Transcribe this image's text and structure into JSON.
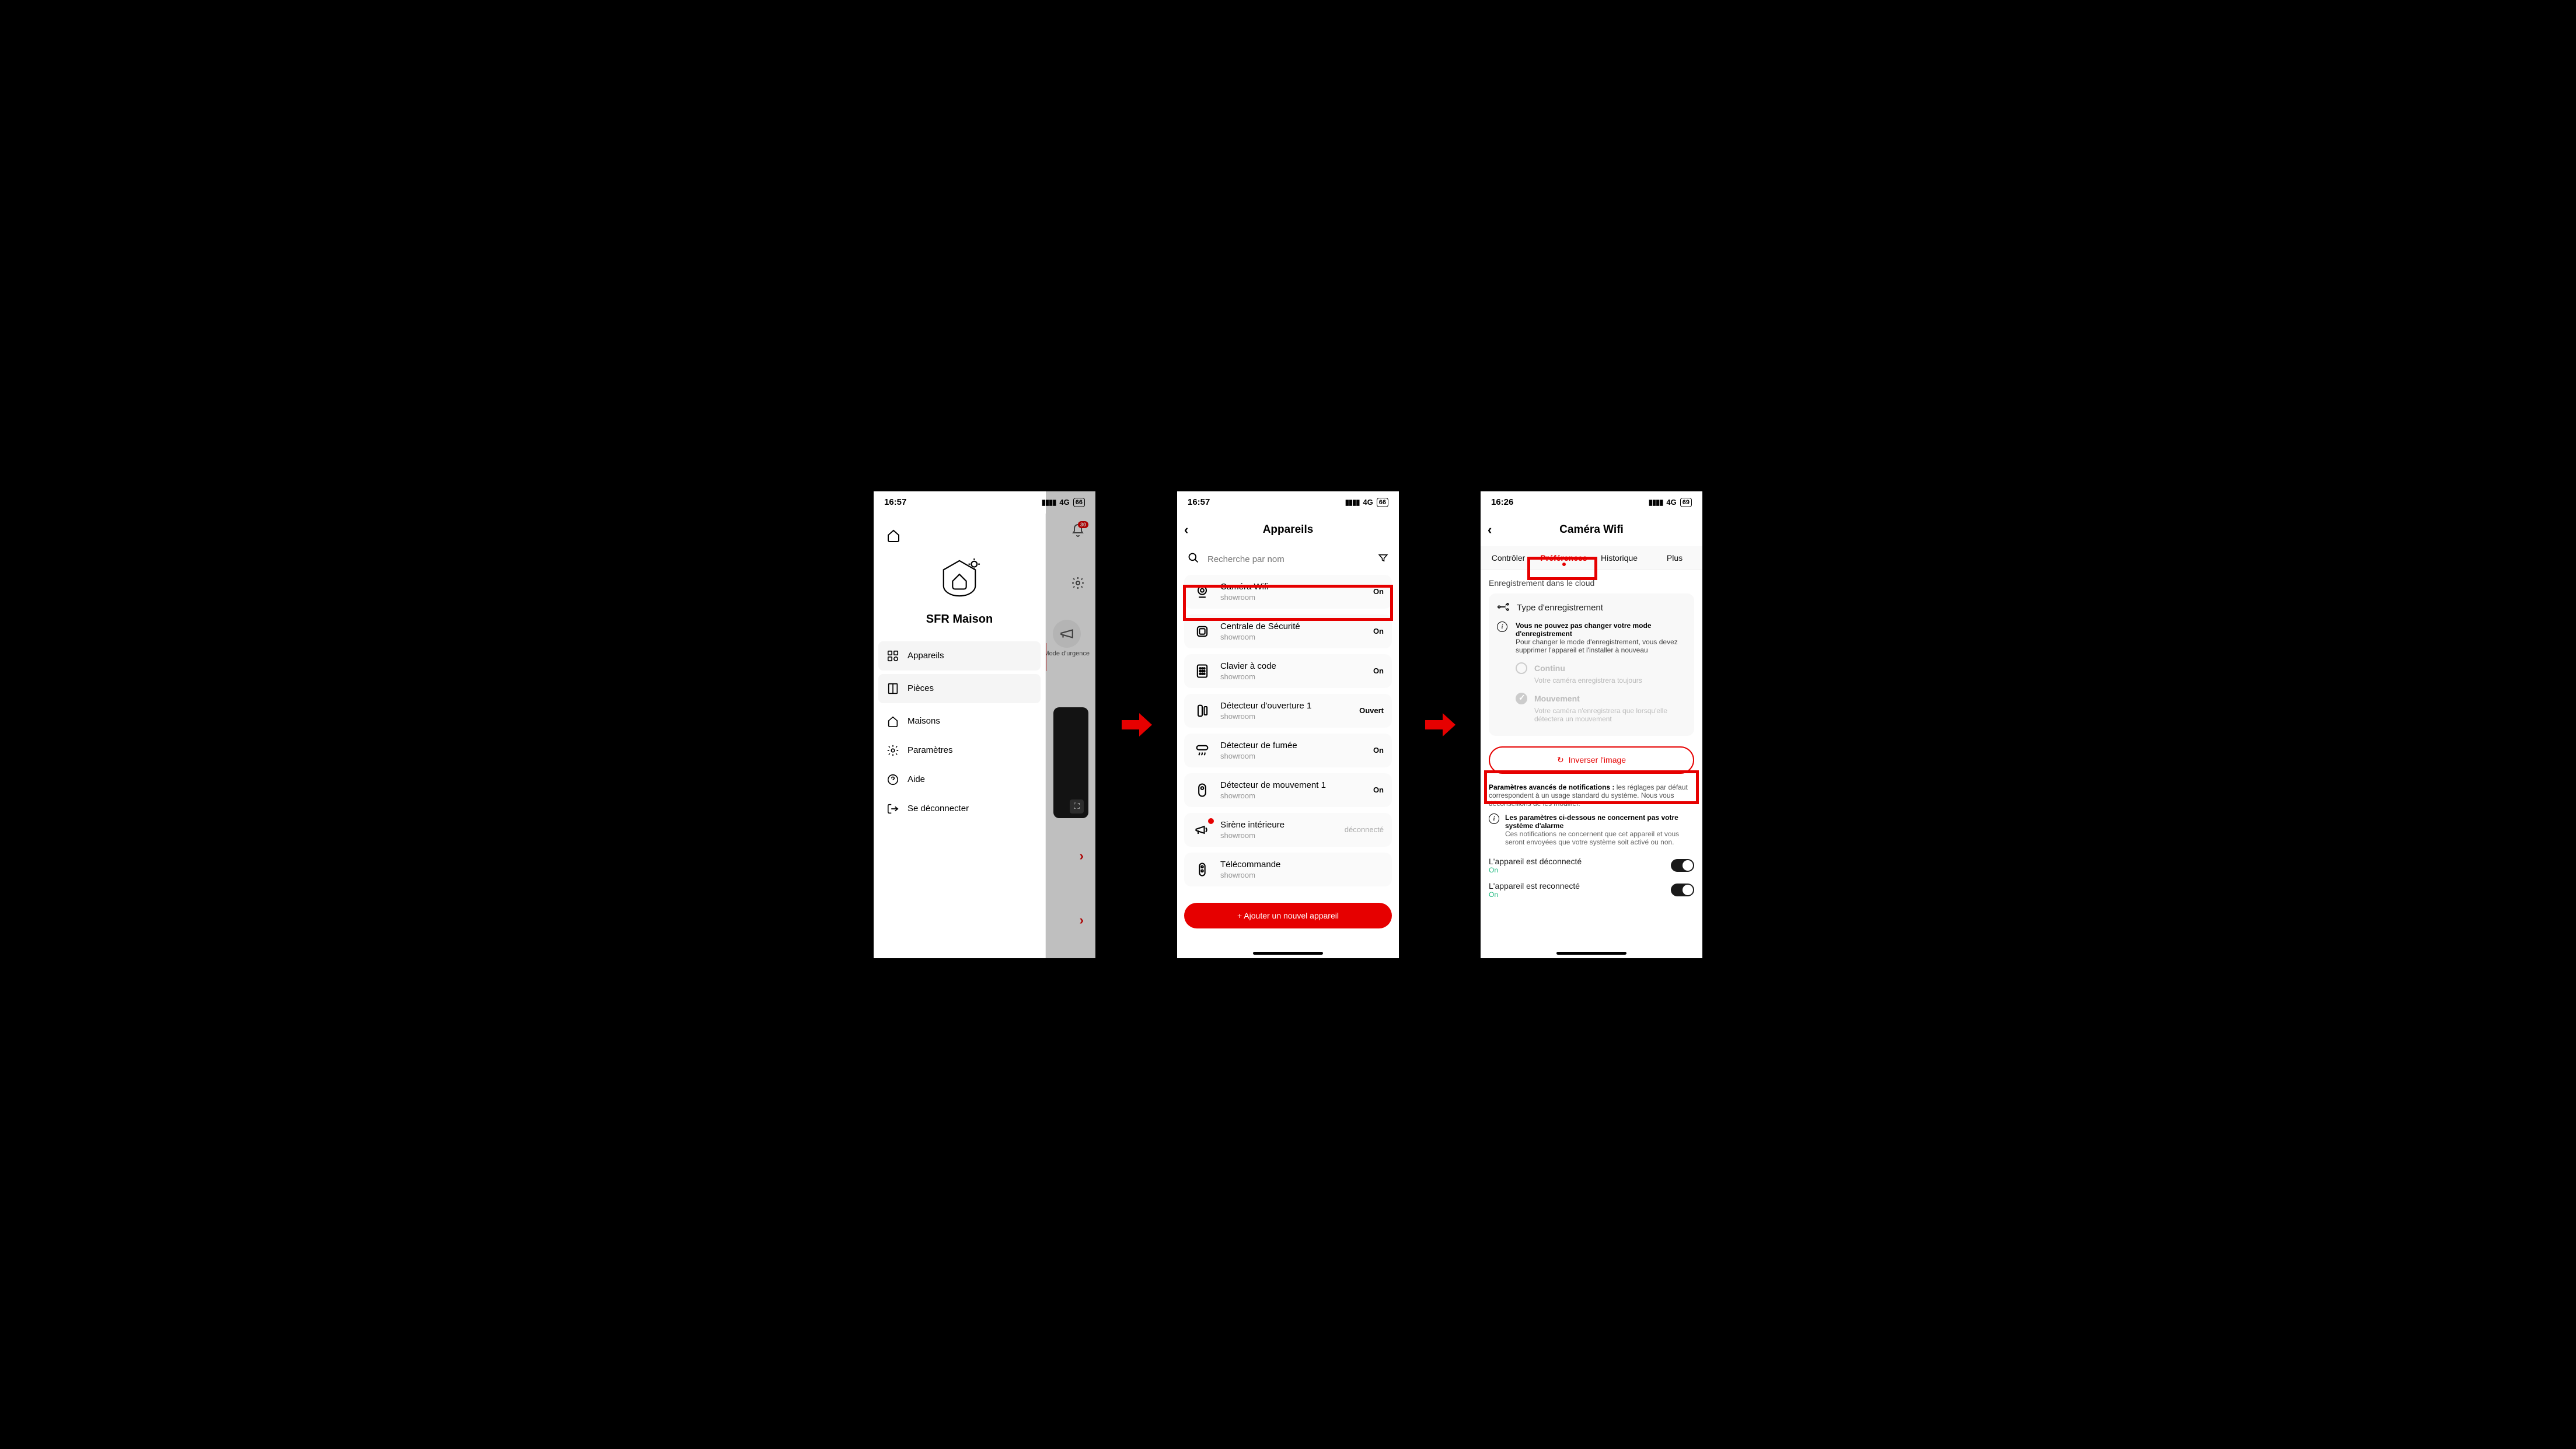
{
  "arrow_color": "#e60000",
  "screen1": {
    "status": {
      "time": "16:57",
      "net": "4G",
      "battery": "66"
    },
    "bg": {
      "bell_badge": "30",
      "mode_label": "Mode d'urgence"
    },
    "drawer": {
      "title": "SFR Maison",
      "items": {
        "appareils": "Appareils",
        "pieces": "Pièces",
        "maisons": "Maisons",
        "parametres": "Paramètres",
        "aide": "Aide",
        "deconnecter": "Se déconnecter"
      }
    }
  },
  "screen2": {
    "status": {
      "time": "16:57",
      "net": "4G",
      "battery": "66"
    },
    "header": "Appareils",
    "search_placeholder": "Recherche par nom",
    "list": [
      {
        "name": "Caméra Wifi",
        "sub": "showroom",
        "state": "On"
      },
      {
        "name": "Centrale de Sécurité",
        "sub": "showroom",
        "state": "On"
      },
      {
        "name": "Clavier à code",
        "sub": "showroom",
        "state": "On"
      },
      {
        "name": "Détecteur d'ouverture 1",
        "sub": "showroom",
        "state": "Ouvert"
      },
      {
        "name": "Détecteur de fumée",
        "sub": "showroom",
        "state": "On"
      },
      {
        "name": "Détecteur de mouvement 1",
        "sub": "showroom",
        "state": "On"
      },
      {
        "name": "Sirène intérieure",
        "sub": "showroom",
        "state": "déconnecté"
      },
      {
        "name": "Télécommande",
        "sub": "showroom",
        "state": ""
      }
    ],
    "add_label": "+ Ajouter un nouvel appareil"
  },
  "screen3": {
    "status": {
      "time": "16:26",
      "net": "4G",
      "battery": "69"
    },
    "header": "Caméra Wifi",
    "tabs": {
      "controler": "Contrôler",
      "preferences": "Préférences",
      "historique": "Historique",
      "plus": "Plus"
    },
    "section_cloud": "Enregistrement dans le cloud",
    "type_label": "Type d'enregistrement",
    "warn_title": "Vous ne pouvez pas changer votre mode d'enregistrement",
    "warn_body": "Pour changer le mode d'enregistrement, vous devez supprimer l'appareil et l'installer à nouveau",
    "opt_continu": "Continu",
    "opt_continu_desc": "Votre caméra enregistrera toujours",
    "opt_mouv": "Mouvement",
    "opt_mouv_desc": "Votre caméra n'enregistrera que lorsqu'elle détectera un mouvement",
    "invert_label": "Inverser l'image",
    "adv_title": "Paramètres avancés de notifications :",
    "adv_body": "les réglages par défaut correspondent à un usage standard du système. Nous vous déconseillons de les modifier.",
    "info2_title": "Les paramètres ci-dessous ne concernent pas votre système d'alarme",
    "info2_body": "Ces notifications ne concernent que cet appareil et vous seront envoyées que votre système soit activé ou non.",
    "toggle1": {
      "label": "L'appareil est déconnecté",
      "state": "On"
    },
    "toggle2": {
      "label": "L'appareil est reconnecté",
      "state": "On"
    }
  }
}
